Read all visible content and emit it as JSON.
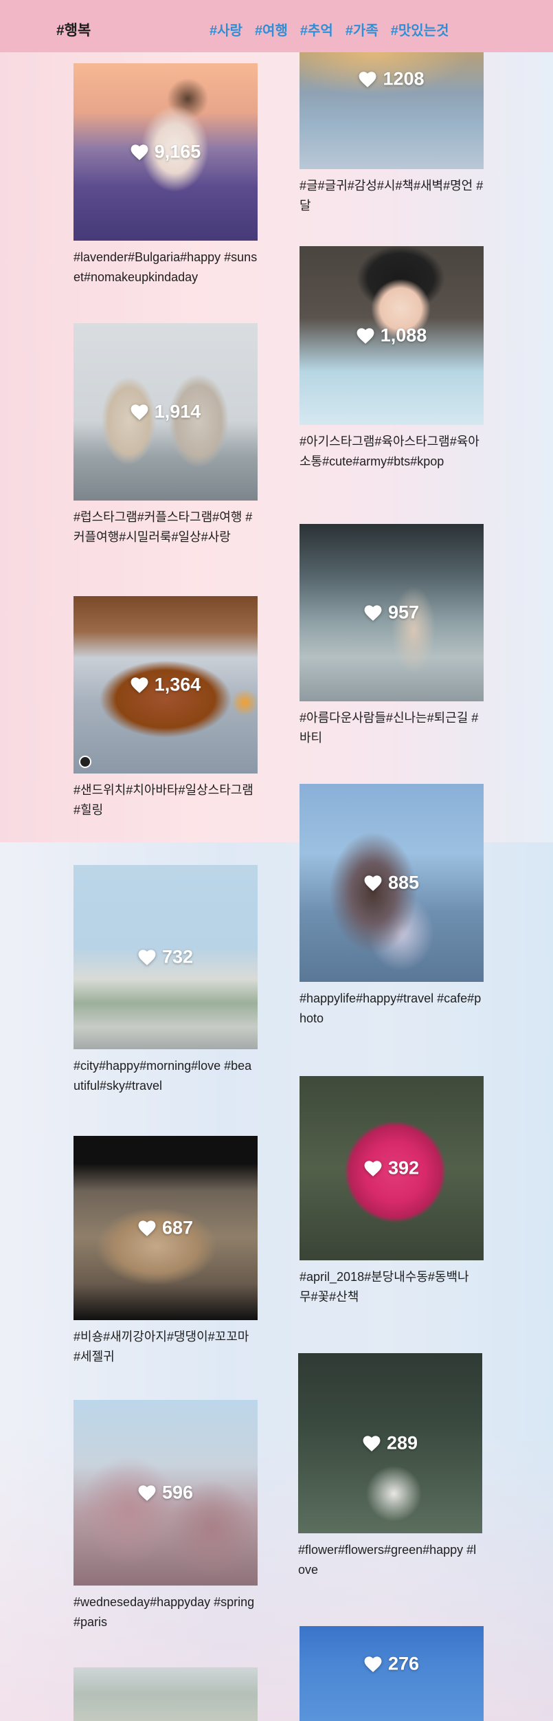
{
  "header": {
    "logo": "#행복",
    "nav": [
      "#사랑",
      "#여행",
      "#추억",
      "#가족",
      "#맛있는것"
    ]
  },
  "posts": [
    {
      "likes": "9,165",
      "tags": "#lavender#Bulgaria#happy #sunset#nomakeupkindaday",
      "icon": "heart-icon"
    },
    {
      "likes": "1208",
      "tags": "#글#글귀#감성#시#책#새벽#명언 #달",
      "icon": "heart-icon"
    },
    {
      "likes": "1,088",
      "tags": "#아기스타그램#육아스타그램#육아 소통#cute#army#bts#kpop",
      "icon": "heart-icon"
    },
    {
      "likes": "1,914",
      "tags": "#럽스타그램#커플스타그램#여행 #커플여행#시밀러룩#일상#사랑",
      "icon": "heart-icon"
    },
    {
      "likes": "957",
      "tags": "#아름다운사람들#신나는#퇴근길 #바티",
      "icon": "heart-icon"
    },
    {
      "likes": "1,364",
      "tags": "#샌드위치#치아바타#일상스타그램 #힐링",
      "icon": "heart-icon"
    },
    {
      "likes": "885",
      "tags": "#happylife#happy#travel #cafe#photo",
      "icon": "heart-icon"
    },
    {
      "likes": "732",
      "tags": "#city#happy#morning#love #beautiful#sky#travel",
      "icon": "heart-icon"
    },
    {
      "likes": "392",
      "tags": "#april_2018#분당내수동#동백나 무#꽃#산책",
      "icon": "heart-icon"
    },
    {
      "likes": "687",
      "tags": "#비숑#새끼강아지#댕댕이#꼬꼬마 #세젤귀",
      "icon": "heart-icon"
    },
    {
      "likes": "289",
      "tags": "#flower#flowers#green#happy #love",
      "icon": "heart-icon"
    },
    {
      "likes": "596",
      "tags": "#wedneseday#happyday #spring#paris",
      "icon": "heart-icon"
    },
    {
      "likes": "276",
      "tags": "",
      "icon": "heart-icon"
    }
  ]
}
